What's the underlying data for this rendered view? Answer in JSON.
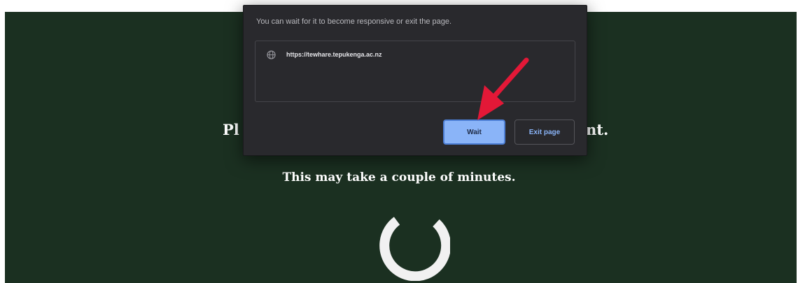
{
  "page": {
    "heading_left": "Pl",
    "heading_right": "nt.",
    "subheading": "This may take a couple of minutes."
  },
  "dialog": {
    "message": "You can wait for it to become responsive or exit the page.",
    "url": "https://tewhare.tepukenga.ac.nz",
    "wait_label": "Wait",
    "exit_label": "Exit page"
  },
  "icons": {
    "globe": "globe-icon",
    "spinner": "loading-spinner-icon",
    "annotation_arrow": "red-arrow-icon"
  },
  "colors": {
    "page_background": "#1b3021",
    "dialog_background": "#29292d",
    "primary_button": "#8ab4f8",
    "arrow": "#e31837"
  }
}
